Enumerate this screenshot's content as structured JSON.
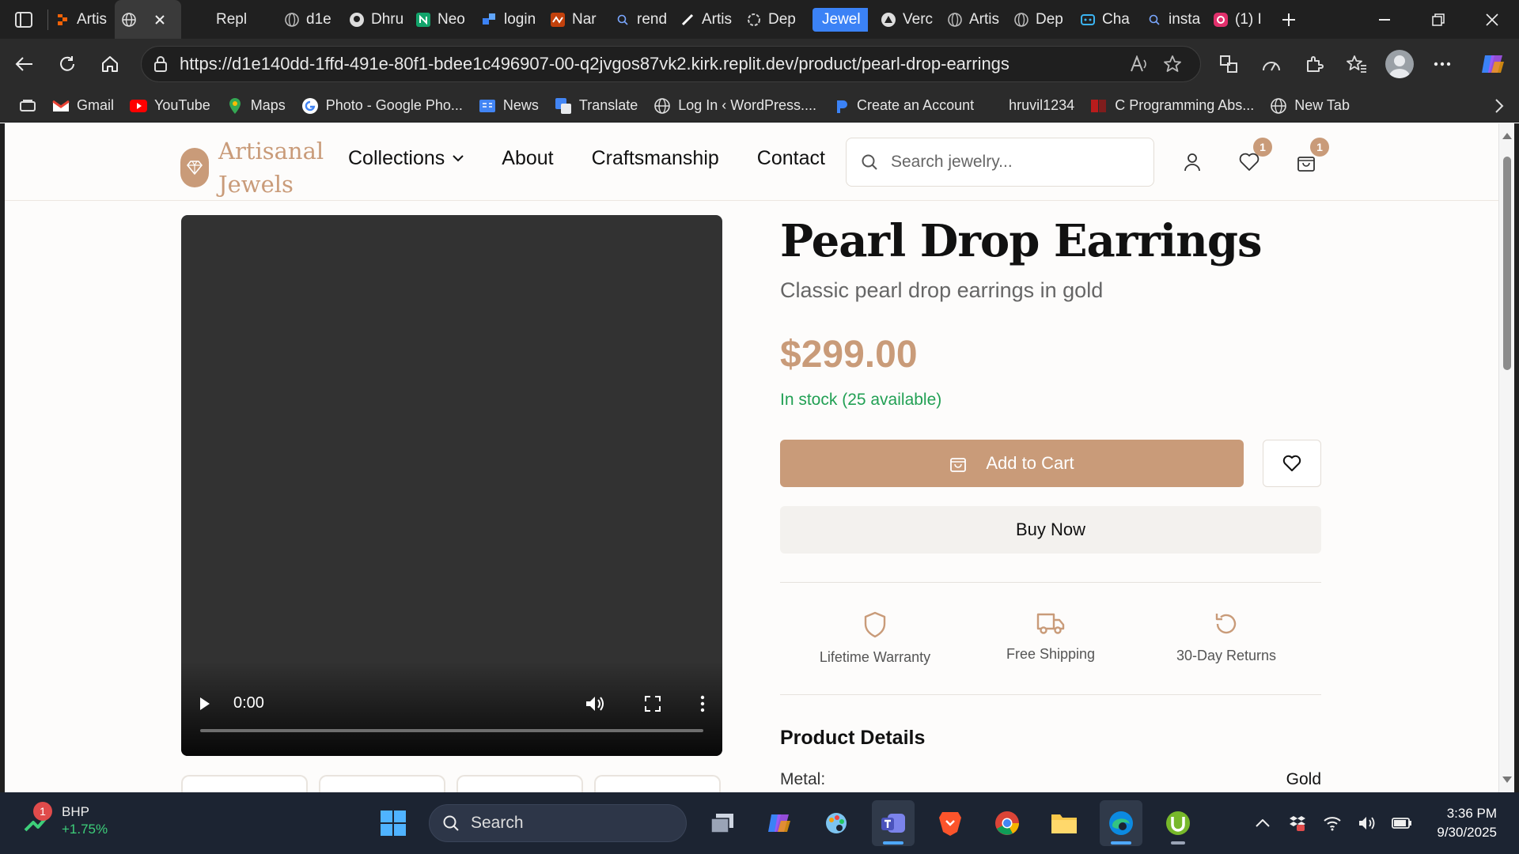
{
  "browser": {
    "tabs": [
      {
        "label": "Artis",
        "active": false
      },
      {
        "label": "",
        "active": true
      },
      {
        "label": "Repl",
        "active": false
      },
      {
        "label": "d1e",
        "active": false
      },
      {
        "label": "Dhru",
        "active": false
      },
      {
        "label": "Neo",
        "active": false
      },
      {
        "label": "login",
        "active": false
      },
      {
        "label": "Nar",
        "active": false
      },
      {
        "label": "rend",
        "active": false
      },
      {
        "label": "Artis",
        "active": false
      },
      {
        "label": "Dep",
        "active": false
      },
      {
        "label": "Jewel",
        "active": false
      },
      {
        "label": "Verc",
        "active": false
      },
      {
        "label": "Artis",
        "active": false
      },
      {
        "label": "Dep",
        "active": false
      },
      {
        "label": "Cha",
        "active": false
      },
      {
        "label": "insta",
        "active": false
      },
      {
        "label": "(1) I",
        "active": false
      }
    ],
    "url": "https://d1e140dd-1ffd-491e-80f1-bdee1c496907-00-q2jvgos87vk2.kirk.replit.dev/product/pearl-drop-earrings",
    "bookmarks": [
      {
        "label": "Gmail"
      },
      {
        "label": "YouTube"
      },
      {
        "label": "Maps"
      },
      {
        "label": "Photo - Google Pho..."
      },
      {
        "label": "News"
      },
      {
        "label": "Translate"
      },
      {
        "label": "Log In ‹ WordPress...."
      },
      {
        "label": "Create an Account"
      },
      {
        "label": "hruvil1234"
      },
      {
        "label": "C Programming Abs..."
      },
      {
        "label": "New Tab"
      }
    ]
  },
  "site": {
    "logo_line1": "Artisanal",
    "logo_line2": "Jewels",
    "nav": {
      "collections": "Collections",
      "about": "About",
      "craftsmanship": "Craftsmanship",
      "contact": "Contact"
    },
    "search_placeholder": "Search jewelry...",
    "wishlist_count": "1",
    "cart_count": "1",
    "accent_color": "#c99b79"
  },
  "product": {
    "title": "Pearl Drop Earrings",
    "subtitle": "Classic pearl drop earrings in gold",
    "price": "$299.00",
    "stock": "In stock (25 available)",
    "add_to_cart": "Add to Cart",
    "buy_now": "Buy Now",
    "video_time": "0:00",
    "features": [
      {
        "icon": "shield-icon",
        "label": "Lifetime Warranty"
      },
      {
        "icon": "truck-icon",
        "label": "Free Shipping"
      },
      {
        "icon": "rotate-ccw-icon",
        "label": "30-Day Returns"
      }
    ],
    "details_heading": "Product Details",
    "details": [
      {
        "label": "Metal:",
        "value": "Gold"
      }
    ]
  },
  "taskbar": {
    "stock_name": "BHP",
    "stock_change": "+1.75%",
    "notification_count": "1",
    "search_label": "Search",
    "time": "3:36 PM",
    "date": "9/30/2025"
  }
}
